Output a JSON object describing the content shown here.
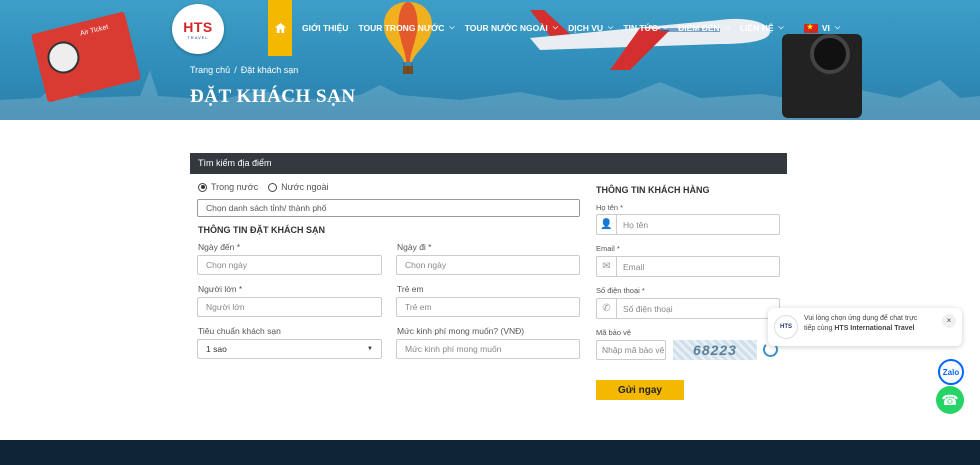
{
  "logo": {
    "text_main": "HTS",
    "text_sub": "TRAVEL"
  },
  "nav": {
    "home_icon": "home-icon",
    "items": [
      {
        "label": "Giới thiệu",
        "has_dropdown": false
      },
      {
        "label": "Tour trong nước",
        "has_dropdown": true
      },
      {
        "label": "Tour nước ngoài",
        "has_dropdown": true
      },
      {
        "label": "Dịch vụ",
        "has_dropdown": true
      },
      {
        "label": "Tin tức",
        "has_dropdown": true
      },
      {
        "label": "Điểm đến",
        "has_dropdown": true
      },
      {
        "label": "Liên hệ",
        "has_dropdown": true
      }
    ],
    "lang": "VI"
  },
  "breadcrumb": {
    "home": "Trang chủ",
    "current": "Đặt khách sạn"
  },
  "page_title": "ĐẶT KHÁCH SẠN",
  "decor": {
    "ticket_text": "Air Ticket"
  },
  "search": {
    "header": "Tìm kiếm địa điểm",
    "radio_domestic": "Trong nước",
    "radio_foreign": "Nước ngoài",
    "location_placeholder": "Chọn danh sách tỉnh/ thành phố"
  },
  "booking": {
    "section_title": "THÔNG TIN ĐẶT KHÁCH SẠN",
    "arrive_label": "Ngày đến *",
    "arrive_placeholder": "Chọn ngày",
    "depart_label": "Ngày đi *",
    "depart_placeholder": "Chọn ngày",
    "adults_label": "Người lớn *",
    "adults_placeholder": "Người lớn",
    "children_label": "Trẻ em",
    "children_placeholder": "Trẻ em",
    "standard_label": "Tiêu chuẩn khách sạn",
    "standard_value": "1 sao",
    "budget_label": "Mức kinh phí mong muốn? (VNĐ)",
    "budget_placeholder": "Mức kinh phí mong muốn"
  },
  "customer": {
    "section_title": "THÔNG TIN KHÁCH HÀNG",
    "name_label": "Họ tên *",
    "name_placeholder": "Họ tên",
    "email_label": "Email *",
    "email_placeholder": "Email",
    "phone_label": "Số điện thoại *",
    "phone_placeholder": "Số điện thoại",
    "captcha_label": "Mã bảo vệ",
    "captcha_placeholder": "Nhập mã bảo vệ",
    "captcha_text": "68223",
    "submit": "Gửi ngay"
  },
  "chat": {
    "line1": "Vui lòng chọn ứng dụng để chat trực",
    "line2_pre": "tiếp cùng ",
    "brand": "HTS International Travel",
    "avatar_text": "HTS",
    "close": "×"
  },
  "zalo": "Zalo",
  "colors": {
    "accent": "#f5b800",
    "form_header": "#33393f",
    "hero": "#3d9fc7",
    "footer": "#0f2434"
  }
}
